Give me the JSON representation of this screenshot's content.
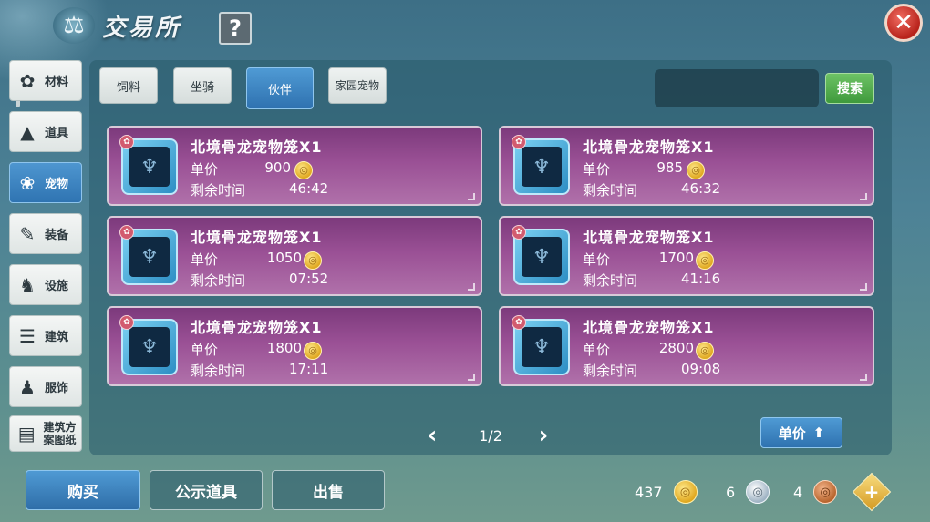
{
  "header": {
    "title": "交易所",
    "help_label": "?",
    "close_label": "✕"
  },
  "sidebar": {
    "items": [
      {
        "label": "材料",
        "icon": "material-icon"
      },
      {
        "label": "道具",
        "icon": "item-icon"
      },
      {
        "label": "宠物",
        "icon": "paw-icon",
        "active": true
      },
      {
        "label": "装备",
        "icon": "equipment-icon"
      },
      {
        "label": "设施",
        "icon": "facility-icon"
      },
      {
        "label": "建筑",
        "icon": "building-icon"
      },
      {
        "label": "服饰",
        "icon": "clothing-icon"
      },
      {
        "label": "建筑方案图纸",
        "icon": "blueprint-icon"
      }
    ]
  },
  "tabs": [
    {
      "label": "饲料"
    },
    {
      "label": "坐骑"
    },
    {
      "label": "伙伴",
      "active": true
    },
    {
      "label": "家园宠物"
    }
  ],
  "search": {
    "placeholder": "",
    "value": "",
    "button_label": "搜索"
  },
  "listings": {
    "price_label": "单价",
    "time_label": "剩余时间",
    "items": [
      {
        "name": "北境骨龙宠物笼X1",
        "price": "900",
        "time": "46:42"
      },
      {
        "name": "北境骨龙宠物笼X1",
        "price": "985",
        "time": "46:32"
      },
      {
        "name": "北境骨龙宠物笼X1",
        "price": "1050",
        "time": "07:52"
      },
      {
        "name": "北境骨龙宠物笼X1",
        "price": "1700",
        "time": "41:16"
      },
      {
        "name": "北境骨龙宠物笼X1",
        "price": "1800",
        "time": "17:11"
      },
      {
        "name": "北境骨龙宠物笼X1",
        "price": "2800",
        "time": "09:08"
      }
    ]
  },
  "pagination": {
    "indicator": "1/2"
  },
  "sort": {
    "label": "单价"
  },
  "bottom": {
    "buy_label": "购买",
    "publicity_label": "公示道具",
    "sell_label": "出售"
  },
  "currency": {
    "gold": "437",
    "silver": "6",
    "bronze": "4"
  },
  "colors": {
    "card_bg": "#9a5095",
    "accent_blue": "#2f72b0",
    "search_green": "#3f9a3c",
    "close_red": "#b8231b"
  }
}
